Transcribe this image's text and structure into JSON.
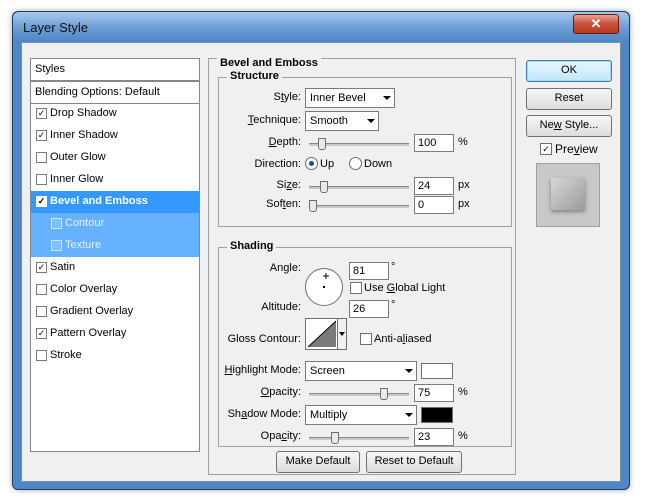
{
  "window": {
    "title": "Layer Style",
    "close_glyph": "✕"
  },
  "sidebar": {
    "styles_header": "Styles",
    "blending_header": "Blending Options: Default",
    "items": [
      {
        "label": "Drop Shadow",
        "checked": true
      },
      {
        "label": "Inner Shadow",
        "checked": true
      },
      {
        "label": "Outer Glow",
        "checked": false
      },
      {
        "label": "Inner Glow",
        "checked": false
      },
      {
        "label": "Bevel and Emboss",
        "checked": true,
        "selected": true
      },
      {
        "label": "Contour",
        "checked": false,
        "sub": true
      },
      {
        "label": "Texture",
        "checked": false,
        "sub": true
      },
      {
        "label": "Satin",
        "checked": true
      },
      {
        "label": "Color Overlay",
        "checked": false
      },
      {
        "label": "Gradient Overlay",
        "checked": false
      },
      {
        "label": "Pattern Overlay",
        "checked": true
      },
      {
        "label": "Stroke",
        "checked": false
      }
    ]
  },
  "bevel": {
    "section_title": "Bevel and Emboss",
    "structure": {
      "title": "Structure",
      "style_label_pre": "S",
      "style_label_u": "t",
      "style_label_post": "yle:",
      "style_value": "Inner Bevel",
      "technique_label_u": "T",
      "technique_label_post": "echnique:",
      "technique_value": "Smooth",
      "depth_label_u": "D",
      "depth_label_post": "epth:",
      "depth_value": "100",
      "depth_unit": "%",
      "depth_fraction": 0.1,
      "direction_label": "Direction:",
      "direction_up": "Up",
      "direction_down": "Down",
      "size_label_pre": "Si",
      "size_label_u": "z",
      "size_label_post": "e:",
      "size_value": "24",
      "size_unit": "px",
      "size_fraction": 0.12,
      "soften_label_pre": "Sof",
      "soften_label_u": "t",
      "soften_label_post": "en:",
      "soften_value": "0",
      "soften_unit": "px",
      "soften_fraction": 0.0
    },
    "shading": {
      "title": "Shading",
      "angle_label_pre": "An",
      "angle_label_u": "g",
      "angle_label_post": "le:",
      "angle_value": "81",
      "angle_unit": "°",
      "global_light_pre": "Use ",
      "global_light_u": "G",
      "global_light_post": "lobal Light",
      "altitude_label": "Altitude:",
      "altitude_value": "26",
      "altitude_unit": "°",
      "gloss_label": "Gloss Contour:",
      "anti_aliased_pre": "Anti-a",
      "anti_aliased_u": "l",
      "anti_aliased_post": "iased",
      "highlight_label_pre": "",
      "highlight_label_u": "H",
      "highlight_label_post": "ighlight Mode:",
      "highlight_mode": "Screen",
      "highlight_color": "#ffffff",
      "opacity1_label_u": "O",
      "opacity1_label_post": "pacity:",
      "opacity1_value": "75",
      "opacity1_unit": "%",
      "opacity1_fraction": 0.75,
      "shadow_label_pre": "Sh",
      "shadow_label_u": "a",
      "shadow_label_post": "dow Mode:",
      "shadow_mode": "Multiply",
      "shadow_color": "#000000",
      "opacity2_label_pre": "Opa",
      "opacity2_label_u": "c",
      "opacity2_label_post": "ity:",
      "opacity2_value": "23",
      "opacity2_unit": "%",
      "opacity2_fraction": 0.23
    },
    "make_default": "Make Default",
    "reset_default": "Reset to Default"
  },
  "actions": {
    "ok": "OK",
    "reset": "Reset",
    "new_style_pre": "Ne",
    "new_style_u": "w",
    "new_style_post": " Style...",
    "preview_pre": "Pre",
    "preview_u": "v",
    "preview_post": "iew",
    "preview_checked": true
  }
}
